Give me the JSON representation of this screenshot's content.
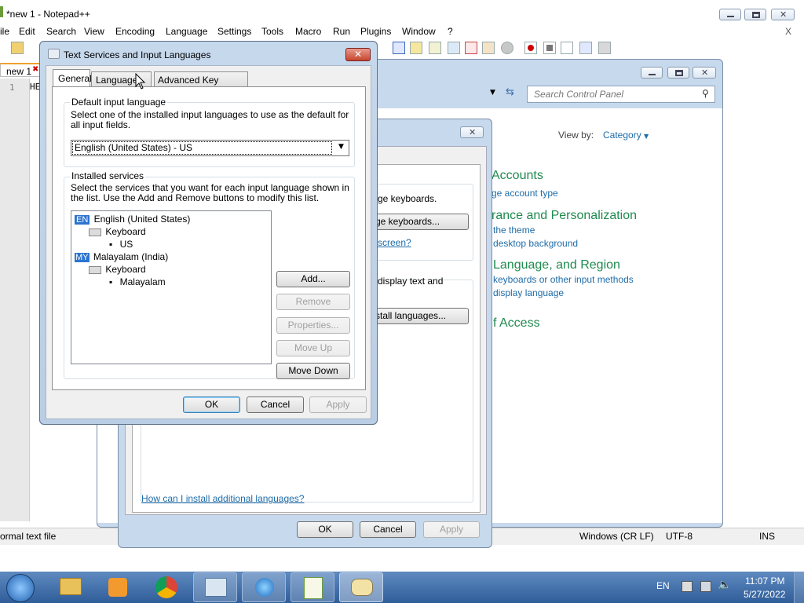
{
  "notepad": {
    "title": "*new 1 - Notepad++",
    "menu": [
      "ile",
      "Edit",
      "Search",
      "View",
      "Encoding",
      "Language",
      "Settings",
      "Tools",
      "Macro",
      "Run",
      "Plugins",
      "Window",
      "?"
    ],
    "close_x": "X",
    "tab": "new 1",
    "line_number": "1",
    "editor_text": "HE",
    "status": {
      "filetype": "ormal text file",
      "eol": "Windows (CR LF)",
      "encoding": "UTF-8",
      "mode": "INS"
    }
  },
  "control_panel": {
    "search_placeholder": "Search Control Panel",
    "view_by_label": "View by:",
    "view_by_value": "Category",
    "sections": [
      {
        "title": "Accounts",
        "links": [
          "ge account type"
        ]
      },
      {
        "title": "rance and Personalization",
        "links": [
          "the theme",
          "desktop background"
        ]
      },
      {
        "title": "Language, and Region",
        "links": [
          "keyboards or other input methods",
          "display language"
        ]
      },
      {
        "title": "f Access",
        "links": []
      }
    ]
  },
  "region_dialog": {
    "text1": "ge keyboards.",
    "btn1": "ge keyboards...",
    "link1": "screen?",
    "text2a": "display text and",
    "btn2": "stall languages...",
    "install_link": "How can I install additional languages?",
    "ok": "OK",
    "cancel": "Cancel",
    "apply": "Apply"
  },
  "tsf": {
    "title": "Text Services and Input Languages",
    "tabs": [
      "General",
      "Language Bar",
      "Advanced Key Settings"
    ],
    "default_group": "Default input language",
    "default_desc": "Select one of the installed input languages to use as the default for all input fields.",
    "default_value": "English (United States) - US",
    "installed_group": "Installed services",
    "installed_desc": "Select the services that you want for each input language shown in the list. Use the Add and Remove buttons to modify this list.",
    "tree": [
      {
        "badge": "EN",
        "label": "English (United States)"
      },
      {
        "label": "Keyboard"
      },
      {
        "label": "US"
      },
      {
        "badge": "MY",
        "label": "Malayalam (India)"
      },
      {
        "label": "Keyboard"
      },
      {
        "label": "Malayalam"
      }
    ],
    "buttons": {
      "add": "Add...",
      "remove": "Remove",
      "properties": "Properties...",
      "move_up": "Move Up",
      "move_down": "Move Down"
    },
    "ok": "OK",
    "cancel": "Cancel",
    "apply": "Apply"
  },
  "taskbar": {
    "lang": "EN",
    "time": "11:07 PM",
    "date": "5/27/2022"
  }
}
